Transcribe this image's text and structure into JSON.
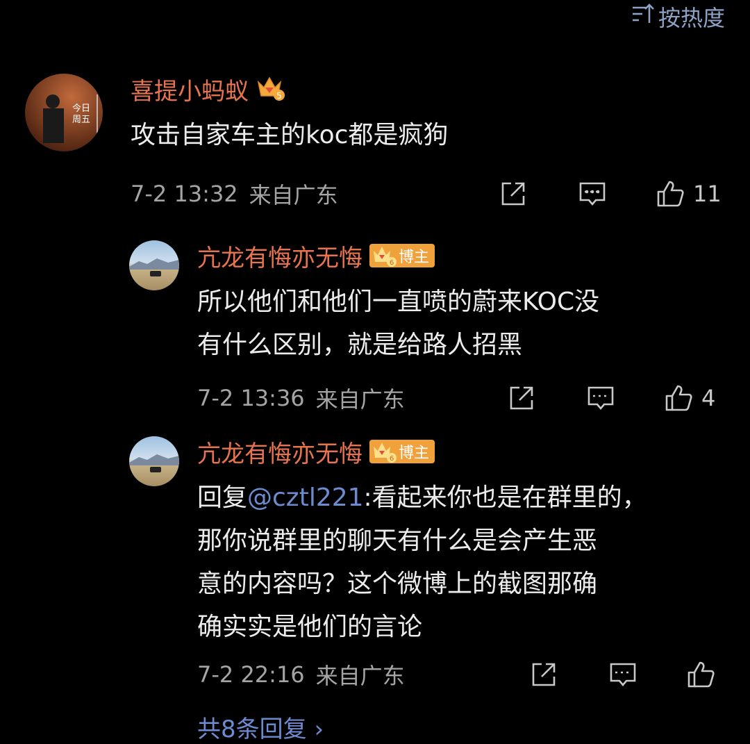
{
  "sort": {
    "label": "按热度",
    "icon": "sort-icon"
  },
  "comments": [
    {
      "user": "喜提小蚂蚁",
      "badge_level": "5",
      "avatar_text_1": "今日",
      "avatar_text_2": "周五",
      "text": "攻击自家车主的koc都是疯狗",
      "time": "7-2 13:32",
      "location": "来自广东",
      "likes": "11"
    },
    {
      "user": "亢龙有悔亦无悔",
      "badge_level": "6",
      "badge_label": "博主",
      "text": "所以他们和他们一直喷的蔚来KOC没\n有什么区别，就是给路人招黑",
      "time": "7-2 13:36",
      "location": "来自广东",
      "likes": "4"
    },
    {
      "user": "亢龙有悔亦无悔",
      "badge_level": "6",
      "badge_label": "博主",
      "reply_prefix": "回复",
      "mention": "@cztl221",
      "text": ":看起来你也是在群里的，\n那你说群里的聊天有什么是会产生恶\n意的内容吗？这个微博上的截图那确\n确实实是他们的言论",
      "time": "7-2 22:16",
      "location": "来自广东",
      "likes": ""
    }
  ],
  "more_replies": "共8条回复 ›",
  "colors": {
    "username": "#e8734f",
    "link": "#6d8bd0",
    "badge": "#f1a13b"
  }
}
